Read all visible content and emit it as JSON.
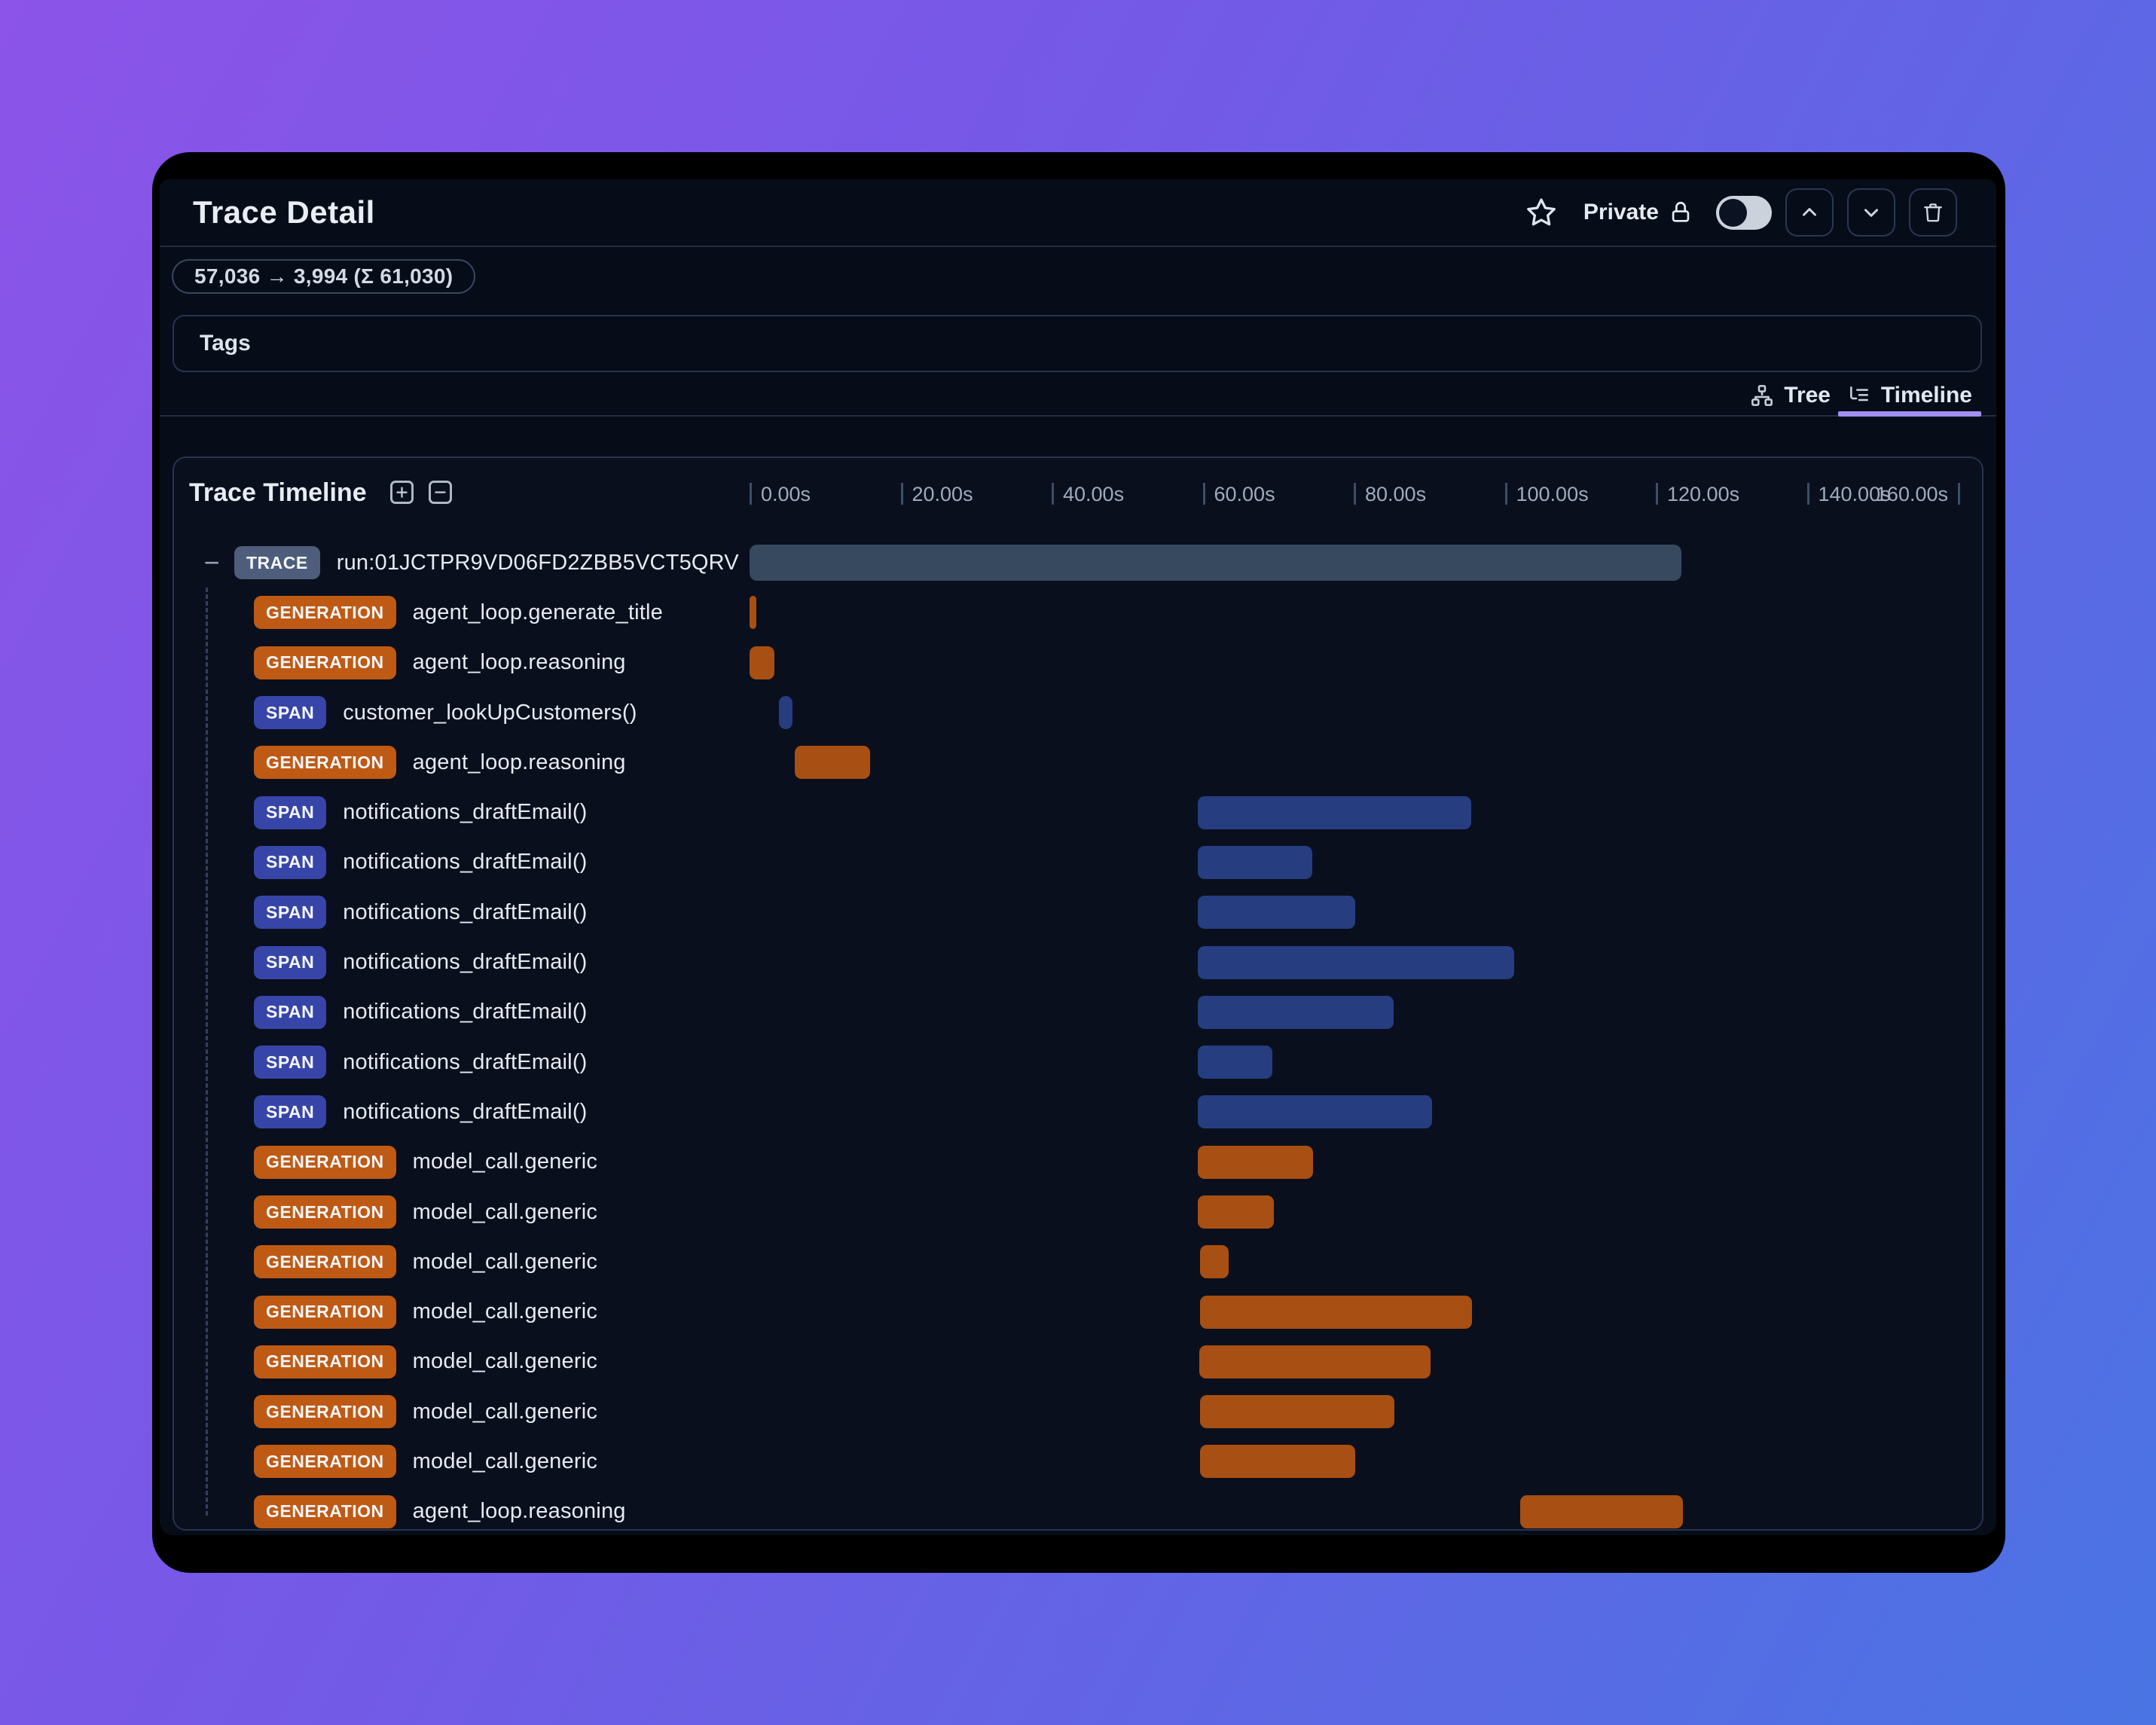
{
  "header": {
    "title": "Trace Detail",
    "privacy_label": "Private",
    "privacy_toggle_state": "off"
  },
  "token_badge": "57,036 → 3,994 (Σ 61,030)",
  "tags": {
    "label": "Tags"
  },
  "tabs": [
    {
      "label": "Tree",
      "active": false
    },
    {
      "label": "Timeline",
      "active": true
    }
  ],
  "timeline": {
    "title": "Trace Timeline",
    "axis": {
      "tick_labels": [
        "0.00s",
        "20.00s",
        "40.00s",
        "60.00s",
        "80.00s",
        "100.00s",
        "120.00s",
        "140.00s",
        "160.00s"
      ],
      "tick_interval_s": 20,
      "range_s": [
        0,
        165
      ]
    },
    "rows": [
      {
        "type": "TRACE",
        "label": "run:01JCTPR9VD06FD2ZBB5VCT5QRV",
        "start_s": 0,
        "end_s": 123.4,
        "root": true
      },
      {
        "type": "GENERATION",
        "label": "agent_loop.generate_title",
        "start_s": 0,
        "end_s": 0.8
      },
      {
        "type": "GENERATION",
        "label": "agent_loop.reasoning",
        "start_s": 0,
        "end_s": 3.3
      },
      {
        "type": "SPAN",
        "label": "customer_lookUpCustomers()",
        "start_s": 3.9,
        "end_s": 5.7
      },
      {
        "type": "GENERATION",
        "label": "agent_loop.reasoning",
        "start_s": 6.0,
        "end_s": 16.0
      },
      {
        "type": "SPAN",
        "label": "notifications_draftEmail()",
        "start_s": 59.4,
        "end_s": 95.6
      },
      {
        "type": "SPAN",
        "label": "notifications_draftEmail()",
        "start_s": 59.4,
        "end_s": 74.5
      },
      {
        "type": "SPAN",
        "label": "notifications_draftEmail()",
        "start_s": 59.4,
        "end_s": 80.2
      },
      {
        "type": "SPAN",
        "label": "notifications_draftEmail()",
        "start_s": 59.4,
        "end_s": 101.2
      },
      {
        "type": "SPAN",
        "label": "notifications_draftEmail()",
        "start_s": 59.4,
        "end_s": 85.3
      },
      {
        "type": "SPAN",
        "label": "notifications_draftEmail()",
        "start_s": 59.4,
        "end_s": 69.2
      },
      {
        "type": "SPAN",
        "label": "notifications_draftEmail()",
        "start_s": 59.4,
        "end_s": 90.4
      },
      {
        "type": "GENERATION",
        "label": "model_call.generic",
        "start_s": 59.4,
        "end_s": 74.6
      },
      {
        "type": "GENERATION",
        "label": "model_call.generic",
        "start_s": 59.4,
        "end_s": 69.4
      },
      {
        "type": "GENERATION",
        "label": "model_call.generic",
        "start_s": 59.7,
        "end_s": 63.4
      },
      {
        "type": "GENERATION",
        "label": "model_call.generic",
        "start_s": 59.7,
        "end_s": 95.7
      },
      {
        "type": "GENERATION",
        "label": "model_call.generic",
        "start_s": 59.6,
        "end_s": 90.2
      },
      {
        "type": "GENERATION",
        "label": "model_call.generic",
        "start_s": 59.7,
        "end_s": 85.4
      },
      {
        "type": "GENERATION",
        "label": "model_call.generic",
        "start_s": 59.7,
        "end_s": 80.2
      },
      {
        "type": "GENERATION",
        "label": "agent_loop.reasoning",
        "start_s": 102.0,
        "end_s": 123.6
      }
    ]
  },
  "icons": {
    "favorite": "star-outline",
    "privacy": "lock",
    "move-up": "chevron-up",
    "move-down": "chevron-down",
    "delete": "trash",
    "tree-view": "org-tree",
    "timeline-view": "list-tree",
    "expand-all": "plus-square",
    "collapse-all": "minus-square",
    "collapse-row": "minus"
  },
  "colors": {
    "background_gradient_from": "#8c54e9",
    "background_gradient_to": "#4a74e3",
    "frame": "#000000",
    "panel_bg": "#070d18",
    "card_bg": "#0a0f1d",
    "border": "#27334f",
    "active_tab_underline": "#a28ef3",
    "trace_bar": "#36495f",
    "trace_badge": "#4e5d7c",
    "generation_bar": "#a84f13",
    "generation_badge": "#bf5a15",
    "span_bar": "#263d80",
    "span_badge": "#3845a8",
    "toggle_track": "#cbd2dc"
  }
}
